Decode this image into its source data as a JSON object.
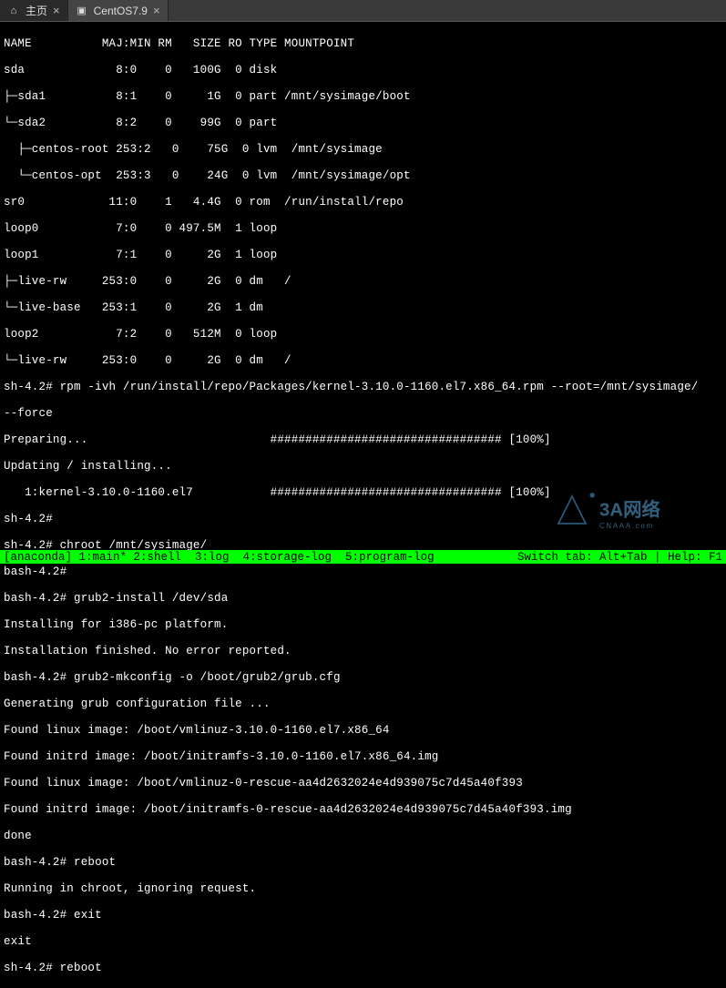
{
  "tabs": [
    {
      "label": "主页",
      "icon": "⌂"
    },
    {
      "label": "CentOS7.9",
      "icon": "▣"
    }
  ],
  "header": "NAME          MAJ:MIN RM   SIZE RO TYPE MOUNTPOINT",
  "devices": [
    "sda             8:0    0   100G  0 disk",
    "├─sda1          8:1    0     1G  0 part /mnt/sysimage/boot",
    "└─sda2          8:2    0    99G  0 part",
    "  ├─centos-root 253:2   0    75G  0 lvm  /mnt/sysimage",
    "  └─centos-opt  253:3   0    24G  0 lvm  /mnt/sysimage/opt",
    "sr0            11:0    1   4.4G  0 rom  /run/install/repo",
    "loop0           7:0    0 497.5M  1 loop",
    "loop1           7:1    0     2G  1 loop",
    "├─live-rw     253:0    0     2G  0 dm   /",
    "└─live-base   253:1    0     2G  1 dm",
    "loop2           7:2    0   512M  0 loop",
    "└─live-rw     253:0    0     2G  0 dm   /"
  ],
  "lines": [
    "sh-4.2# rpm -ivh /run/install/repo/Packages/kernel-3.10.0-1160.el7.x86_64.rpm --root=/mnt/sysimage/",
    "--force",
    "Preparing...                          ################################# [100%]",
    "Updating / installing...",
    "   1:kernel-3.10.0-1160.el7           ################################# [100%]",
    "sh-4.2#",
    "sh-4.2# chroot /mnt/sysimage/",
    "bash-4.2#",
    "bash-4.2# grub2-install /dev/sda",
    "Installing for i386-pc platform.",
    "Installation finished. No error reported.",
    "bash-4.2# grub2-mkconfig -o /boot/grub2/grub.cfg",
    "Generating grub configuration file ...",
    "Found linux image: /boot/vmlinuz-3.10.0-1160.el7.x86_64",
    "Found initrd image: /boot/initramfs-3.10.0-1160.el7.x86_64.img",
    "Found linux image: /boot/vmlinuz-0-rescue-aa4d2632024e4d939075c7d45a40f393",
    "Found initrd image: /boot/initramfs-0-rescue-aa4d2632024e4d939075c7d45a40f393.img",
    "done",
    "bash-4.2# reboot",
    "Running in chroot, ignoring request.",
    "bash-4.2# exit",
    "exit",
    "sh-4.2# reboot"
  ],
  "status_left": "[anaconda] 1:main* 2:shell  3:log  4:storage-log  5:program-log",
  "status_right": "Switch tab: Alt+Tab | Help: F1",
  "watermark_big": "3A网络",
  "watermark_small": "CNAAA.com"
}
